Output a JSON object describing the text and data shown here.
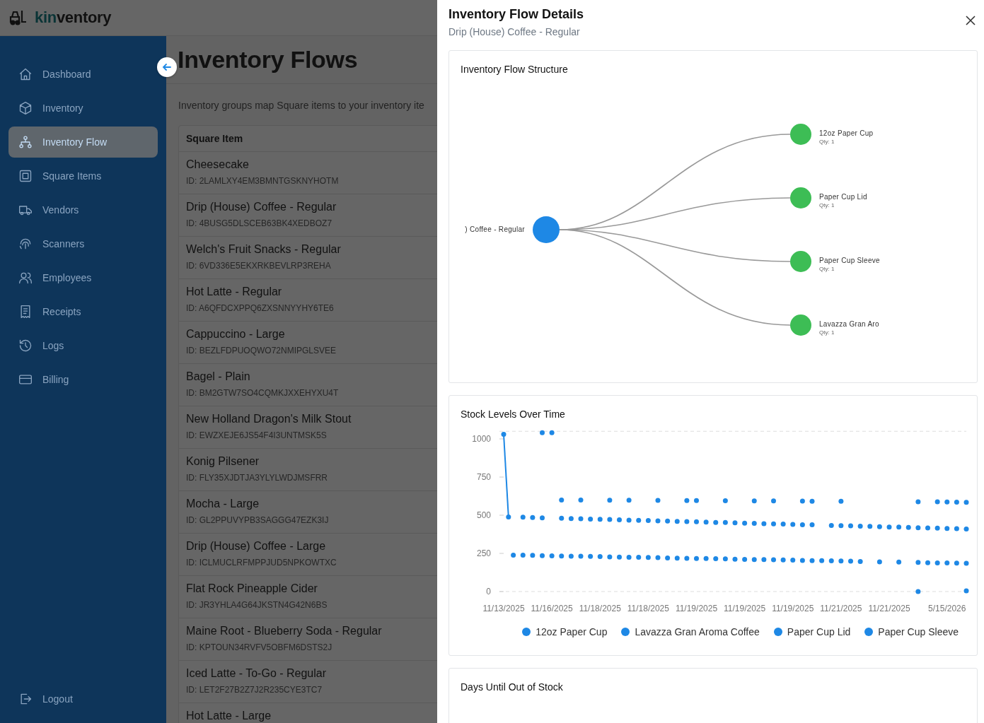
{
  "app": {
    "logo_prefix": "kin",
    "logo_suffix": "ventory"
  },
  "sidebar": {
    "items": [
      {
        "label": "Dashboard",
        "kind": "home",
        "selected": false
      },
      {
        "label": "Inventory",
        "kind": "box",
        "selected": false
      },
      {
        "label": "Inventory Flow",
        "kind": "flow",
        "selected": true
      },
      {
        "label": "Square Items",
        "kind": "square",
        "selected": false
      },
      {
        "label": "Vendors",
        "kind": "truck",
        "selected": false
      },
      {
        "label": "Scanners",
        "kind": "scan",
        "selected": false
      },
      {
        "label": "Employees",
        "kind": "people",
        "selected": false
      },
      {
        "label": "Receipts",
        "kind": "receipt",
        "selected": false
      },
      {
        "label": "Logs",
        "kind": "history",
        "selected": false
      },
      {
        "label": "Billing",
        "kind": "card",
        "selected": false
      }
    ],
    "logout": "Logout"
  },
  "page": {
    "title": "Inventory Flows",
    "description": "Inventory groups map Square items to your inventory ite",
    "table": {
      "columns": [
        "Square Item"
      ],
      "rows": [
        {
          "name": "Cheesecake",
          "id": "ID: 2LAMLXY4EM3BMNTGSKNYHOTM"
        },
        {
          "name": "Drip (House) Coffee - Regular",
          "id": "ID: 4BUSG5DLSCEB63BK4XEDBOZ7"
        },
        {
          "name": "Welch's Fruit Snacks - Regular",
          "id": "ID: 6VD336E5EKXRKBEVLRP3REHA"
        },
        {
          "name": "Hot Latte - Regular",
          "id": "ID: A6QFDCXPPQ6ZXSNNYYHY6TE6"
        },
        {
          "name": "Cappuccino - Large",
          "id": "ID: BEZLFDPUOQWO72NMIPGLSVEE"
        },
        {
          "name": "Bagel - Plain",
          "id": "ID: BM2GTW7SO4CQMKJXXEHYXU4T"
        },
        {
          "name": "New Holland Dragon's Milk Stout",
          "id": "ID: EWZXEJE6JS54F4I3UNTMSK5S"
        },
        {
          "name": "Konig Pilsener",
          "id": "ID: FLY35XJDTJA3YLYLWDJMSFRR"
        },
        {
          "name": "Mocha - Large",
          "id": "ID: GL2PPUVYPB3SAGGG47EZK3IJ"
        },
        {
          "name": "Drip (House) Coffee - Large",
          "id": "ID: ICLMUCLRFMPPJUD5NPKOWTXC"
        },
        {
          "name": "Flat Rock Pineapple Cider",
          "id": "ID: JR3YHLA4G64JKSTN4G42N6BS"
        },
        {
          "name": "Maine Root - Blueberry Soda - Regular",
          "id": "ID: KPTOUN34RVFV5OBFM6DSTS2J"
        },
        {
          "name": "Iced Latte - To-Go - Regular",
          "id": "ID: LET2F27B2Z7J2R235CYE3TC7"
        },
        {
          "name": "Hot Latte - Large"
        }
      ]
    }
  },
  "detail": {
    "title": "Inventory Flow Details",
    "subtitle": "Drip (House) Coffee - Regular",
    "structure": {
      "title": "Inventory Flow Structure",
      "source": ") Coffee - Regular",
      "targets": [
        {
          "name": "12oz Paper Cup",
          "qty": "Qty: 1"
        },
        {
          "name": "Paper Cup Lid",
          "qty": "Qty: 1"
        },
        {
          "name": "Paper Cup Sleeve",
          "qty": "Qty: 1"
        },
        {
          "name": "Lavazza Gran Aro",
          "qty": "Qty: 1"
        }
      ]
    },
    "stock": {
      "title": "Stock Levels Over Time",
      "chart_data": {
        "type": "line",
        "ylim": [
          0,
          1050
        ],
        "categories": [
          "11/13/2025",
          null,
          null,
          null,
          null,
          null,
          null,
          null,
          null,
          null,
          "11/16/2025",
          null,
          null,
          null,
          null,
          null,
          null,
          null,
          null,
          null,
          "11/18/2025",
          null,
          null,
          null,
          null,
          null,
          null,
          null,
          null,
          null,
          "11/18/2025",
          null,
          null,
          null,
          null,
          null,
          null,
          null,
          null,
          null,
          "11/19/2025",
          null,
          null,
          null,
          null,
          null,
          null,
          null,
          null,
          null,
          "11/19/2025",
          null,
          null,
          null,
          null,
          null,
          null,
          null,
          null,
          null,
          "11/19/2025",
          null,
          null,
          null,
          null,
          null,
          null,
          null,
          null,
          null,
          "11/21/2025",
          null,
          null,
          null,
          null,
          null,
          null,
          null,
          null,
          null,
          "11/21/2025",
          null,
          null,
          null,
          null,
          null,
          null,
          null,
          null,
          null,
          null,
          null,
          "5/15/2026",
          null,
          null,
          null,
          null
        ],
        "yticks": [
          0,
          250,
          500,
          750,
          1000
        ],
        "legend": true,
        "series": [
          {
            "name": "12oz Paper Cup",
            "color": "#1e88e5",
            "marker": "circle",
            "values": [
              1030,
              488,
              null,
              null,
              487,
              null,
              485,
              null,
              483,
              null,
              null,
              null,
              480,
              null,
              478,
              null,
              477,
              null,
              475,
              null,
              473,
              null,
              472,
              null,
              470,
              null,
              468,
              null,
              467,
              null,
              465,
              null,
              463,
              null,
              462,
              null,
              460,
              null,
              458,
              null,
              457,
              null,
              455,
              null,
              453,
              null,
              452,
              null,
              450,
              null,
              448,
              null,
              447,
              null,
              445,
              null,
              443,
              null,
              442,
              null,
              440,
              null,
              438,
              null,
              437,
              null,
              null,
              null,
              433,
              null,
              432,
              null,
              430,
              null,
              428,
              null,
              427,
              null,
              425,
              null,
              423,
              null,
              422,
              null,
              420,
              null,
              418,
              null,
              417,
              null,
              415,
              null,
              413,
              null,
              412,
              null,
              410
            ]
          },
          {
            "name": "Lavazza Gran Aroma Coffee",
            "color": "#1e88e5",
            "type": "scatter",
            "values": [
              null,
              null,
              null,
              null,
              null,
              null,
              null,
              null,
              null,
              null,
              null,
              null,
              600,
              null,
              null,
              null,
              600,
              null,
              null,
              null,
              null,
              null,
              598,
              null,
              null,
              null,
              598,
              null,
              null,
              null,
              null,
              null,
              597,
              null,
              null,
              null,
              null,
              null,
              596,
              null,
              596,
              null,
              null,
              null,
              null,
              null,
              595,
              null,
              null,
              null,
              null,
              null,
              594,
              null,
              null,
              null,
              594,
              null,
              null,
              null,
              null,
              null,
              593,
              null,
              592,
              null,
              null,
              null,
              null,
              null,
              592,
              null,
              null,
              null,
              null,
              null,
              null,
              null,
              null,
              null,
              null,
              null,
              null,
              null,
              null,
              null,
              588,
              null,
              null,
              null,
              588,
              null,
              587,
              null,
              586,
              null,
              585
            ]
          },
          {
            "name": "Paper Cup Lid",
            "color": "#1e88e5",
            "type": "scatter",
            "values": [
              null,
              null,
              239,
              null,
              238,
              null,
              237,
              null,
              235,
              null,
              234,
              null,
              233,
              null,
              232,
              null,
              231,
              null,
              230,
              null,
              229,
              null,
              227,
              null,
              226,
              null,
              225,
              null,
              224,
              null,
              223,
              null,
              222,
              null,
              220,
              null,
              219,
              null,
              218,
              null,
              217,
              null,
              216,
              null,
              215,
              null,
              214,
              null,
              212,
              null,
              211,
              null,
              210,
              null,
              209,
              null,
              208,
              null,
              207,
              null,
              206,
              null,
              204,
              null,
              203,
              null,
              202,
              null,
              201,
              null,
              200,
              null,
              199,
              null,
              197,
              null,
              null,
              null,
              195,
              null,
              null,
              null,
              193,
              null,
              null,
              null,
              191,
              null,
              189,
              null,
              188,
              null,
              187,
              null,
              186,
              null,
              185
            ]
          },
          {
            "name": "Paper Cup Sleeve",
            "color": "#1e88e5",
            "type": "scatter",
            "values": [
              null,
              null,
              null,
              null,
              null,
              null,
              null,
              null,
              1040,
              null,
              1040,
              null,
              null,
              null,
              null,
              null,
              null,
              null,
              null,
              null,
              null,
              null,
              null,
              null,
              null,
              null,
              null,
              null,
              null,
              null,
              null,
              null,
              null,
              null,
              null,
              null,
              null,
              null,
              null,
              null,
              null,
              null,
              null,
              null,
              null,
              null,
              null,
              null,
              null,
              null,
              null,
              null,
              null,
              null,
              null,
              null,
              null,
              null,
              null,
              null,
              null,
              null,
              null,
              null,
              null,
              null,
              null,
              null,
              null,
              null,
              null,
              null,
              null,
              null,
              null,
              null,
              null,
              null,
              null,
              null,
              null,
              null,
              null,
              null,
              null,
              null,
              0,
              null,
              null,
              null,
              null,
              null,
              null,
              null,
              null,
              null,
              5
            ]
          }
        ]
      }
    },
    "days": {
      "title": "Days Until Out of Stock"
    }
  }
}
